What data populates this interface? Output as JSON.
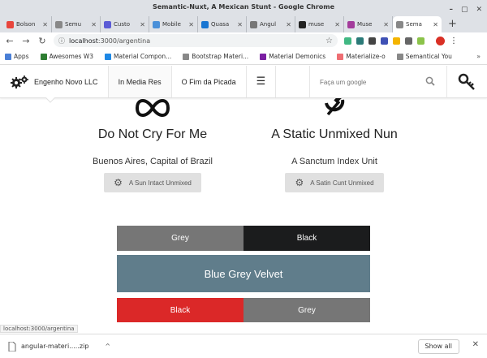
{
  "window": {
    "title": "Semantic-Nuxt, A Mexican Stunt - Google Chrome"
  },
  "tabs": [
    {
      "label": "Bolson",
      "color": "#e8453c"
    },
    {
      "label": "Semu",
      "color": "#888888"
    },
    {
      "label": "Custo",
      "color": "#5c5cd6"
    },
    {
      "label": "Mobile",
      "color": "#4a90d9"
    },
    {
      "label": "Quasa",
      "color": "#1976d2"
    },
    {
      "label": "Angul",
      "color": "#777777"
    },
    {
      "label": "muse",
      "color": "#222222"
    },
    {
      "label": "Muse",
      "color": "#a33c9b"
    },
    {
      "label": "Sema",
      "color": "#888888",
      "active": true
    }
  ],
  "new_tab_label": "+",
  "address": {
    "host": "localhost",
    "path": ":3000/argentina"
  },
  "bookmarks": [
    {
      "label": "Apps",
      "color": "#4a7fd6"
    },
    {
      "label": "Awesomes W3",
      "color": "#2e7d32"
    },
    {
      "label": "Material Compon...",
      "color": "#1e88e5"
    },
    {
      "label": "Bootstrap Materi...",
      "color": "#888888"
    },
    {
      "label": "Material Demonics",
      "color": "#7b1fa2"
    },
    {
      "label": "Materialize-o",
      "color": "#ee6e73"
    },
    {
      "label": "Semantical You",
      "color": "#888888"
    }
  ],
  "header": {
    "brand": "Engenho Novo LLC",
    "nav": [
      "In Media Res",
      "O Fim da Picada"
    ],
    "search_placeholder": "Faça um google"
  },
  "cards": [
    {
      "title": "Do Not Cry For Me",
      "subtitle": "Buenos Aires, Capital of Brazil",
      "button": "A Sun Intact Unmixed"
    },
    {
      "title": "A Static Unmixed Nun",
      "subtitle": "A Sanctum Index Unit",
      "button": "A Satin Cunt Unmixed"
    }
  ],
  "bars": {
    "row1": [
      "Grey",
      "Black"
    ],
    "row2": "Blue Grey Velvet",
    "row3": [
      "Black",
      "Grey"
    ]
  },
  "colors": {
    "grey": "#767676",
    "black": "#1b1c1d",
    "blue_grey": "#607d8b",
    "red": "#db2828"
  },
  "status_url": "localhost:3000/argentina",
  "downloads": {
    "file": "angular-materi.....zip",
    "show_all": "Show all"
  }
}
